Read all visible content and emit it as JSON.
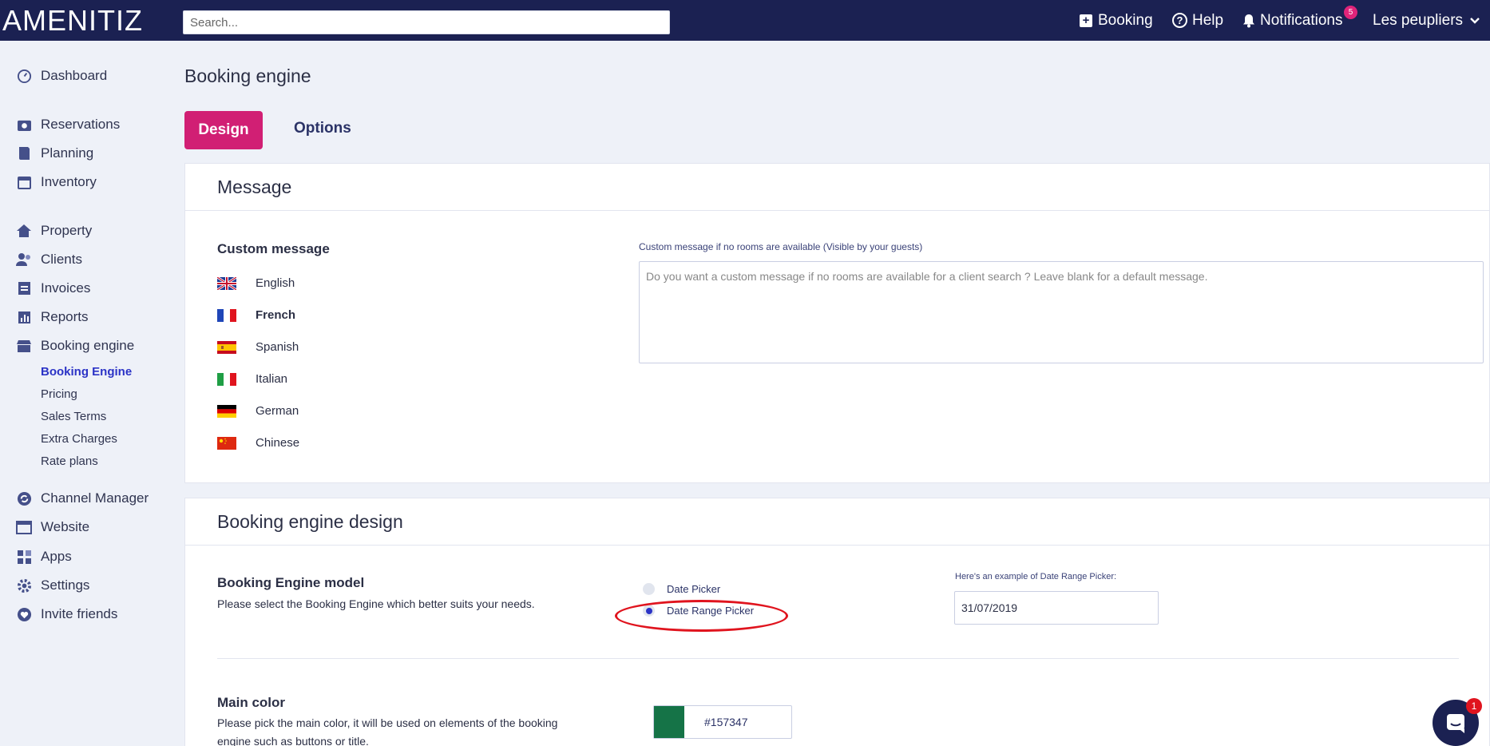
{
  "app": {
    "logo": "AMENITIZ"
  },
  "search": {
    "placeholder": "Search..."
  },
  "topnav": {
    "booking": "Booking",
    "help": "Help",
    "notifications": "Notifications",
    "notifications_count": "5",
    "user": "Les peupliers"
  },
  "sidebar": {
    "dashboard": "Dashboard",
    "reservations": "Reservations",
    "planning": "Planning",
    "inventory": "Inventory",
    "property": "Property",
    "clients": "Clients",
    "invoices": "Invoices",
    "reports": "Reports",
    "booking_engine": "Booking engine",
    "sub": {
      "booking_engine": "Booking Engine",
      "pricing": "Pricing",
      "sales_terms": "Sales Terms",
      "extra_charges": "Extra Charges",
      "rate_plans": "Rate plans"
    },
    "channel_manager": "Channel Manager",
    "website": "Website",
    "apps": "Apps",
    "settings": "Settings",
    "invite_friends": "Invite friends"
  },
  "page": {
    "title": "Booking engine",
    "tabs": {
      "design": "Design",
      "options": "Options"
    }
  },
  "message_card": {
    "title": "Message",
    "custom_message_label": "Custom message",
    "languages": [
      "English",
      "French",
      "Spanish",
      "Italian",
      "German",
      "Chinese"
    ],
    "field_hint": "Custom message if no rooms are available (Visible by your guests)",
    "placeholder": "Do you want a custom message if no rooms are available for a client search ? Leave blank for a default message."
  },
  "design_card": {
    "title": "Booking engine design",
    "model_label": "Booking Engine model",
    "model_desc": "Please select the Booking Engine which better suits your needs.",
    "option_date_picker": "Date Picker",
    "option_date_range_picker": "Date Range Picker",
    "selected_option": "Date Range Picker",
    "example_hint": "Here's an example of Date Range Picker:",
    "example_value": "31/07/2019",
    "main_color_label": "Main color",
    "main_color_desc": "Please pick the main color, it will be used on elements of the booking engine such as buttons or title.",
    "main_color_value": "#157347"
  },
  "chat": {
    "badge": "1"
  },
  "colors": {
    "topbar": "#1b2152",
    "accent": "#d11f74",
    "active_link": "#2b33c6",
    "main_color": "#157347"
  }
}
